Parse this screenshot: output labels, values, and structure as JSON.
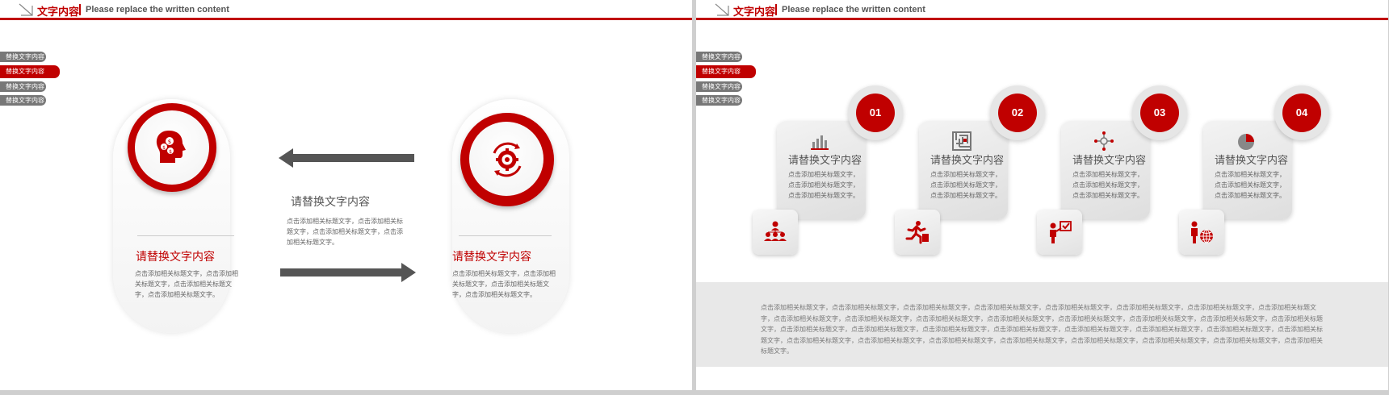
{
  "colors": {
    "accent": "#c00000",
    "gray": "#777777",
    "text": "#555555"
  },
  "header": {
    "title": "文字内容",
    "subtitle": "Please replace the written content"
  },
  "tabs": [
    {
      "label": "替换文字内容",
      "active": false
    },
    {
      "label": "替换文字内容",
      "active": true
    },
    {
      "label": "替换文字内容",
      "active": false
    },
    {
      "label": "替换文字内容",
      "active": false
    }
  ],
  "left_slide": {
    "center": {
      "heading": "请替换文字内容",
      "body": "点击添加相关标题文字，点击添加相关标题文字，点击添加相关标题文字，点击添加相关标题文字。"
    },
    "left_item": {
      "icon": "head-dollar-icon",
      "heading": "请替换文字内容",
      "body": "点击添加相关标题文字，点击添加相关标题文字，点击添加相关标题文字，点击添加相关标题文字。"
    },
    "right_item": {
      "icon": "gear-cycle-icon",
      "heading": "请替换文字内容",
      "body": "点击添加相关标题文字，点击添加相关标题文字，点击添加相关标题文字，点击添加相关标题文字。"
    }
  },
  "right_slide": {
    "cards": [
      {
        "number": "01",
        "icon": "bar-chart-icon",
        "sub_icon": "team-hierarchy-icon",
        "heading": "请替换文字内容",
        "body": "点击添加相关标题文字，点击添加相关标题文字，点击添加相关标题文字。"
      },
      {
        "number": "02",
        "icon": "maze-icon",
        "sub_icon": "running-man-icon",
        "heading": "请替换文字内容",
        "body": "点击添加相关标题文字，点击添加相关标题文字，点击添加相关标题文字。"
      },
      {
        "number": "03",
        "icon": "network-nodes-icon",
        "sub_icon": "presenter-check-icon",
        "heading": "请替换文字内容",
        "body": "点击添加相关标题文字，点击添加相关标题文字，点击添加相关标题文字。"
      },
      {
        "number": "04",
        "icon": "pie-chart-icon",
        "sub_icon": "globe-person-icon",
        "heading": "请替换文字内容",
        "body": "点击添加相关标题文字，点击添加相关标题文字，点击添加相关标题文字。"
      }
    ],
    "band_text": "点击添加相关标题文字，点击添加相关标题文字，点击添加相关标题文字，点击添加相关标题文字，点击添加相关标题文字，点击添加相关标题文字，点击添加相关标题文字，点击添加相关标题文字，点击添加相关标题文字，点击添加相关标题文字，点击添加相关标题文字，点击添加相关标题文字，点击添加相关标题文字，点击添加相关标题文字，点击添加相关标题文字，点击添加相关标题文字，点击添加相关标题文字，点击添加相关标题文字，点击添加相关标题文字，点击添加相关标题文字，点击添加相关标题文字，点击添加相关标题文字，点击添加相关标题文字，点击添加相关标题文字，点击添加相关标题文字，点击添加相关标题文字，点击添加相关标题文字，点击添加相关标题文字，点击添加相关标题文字，点击添加相关标题文字，点击添加相关标题文字，点击添加相关标题文字。"
  }
}
